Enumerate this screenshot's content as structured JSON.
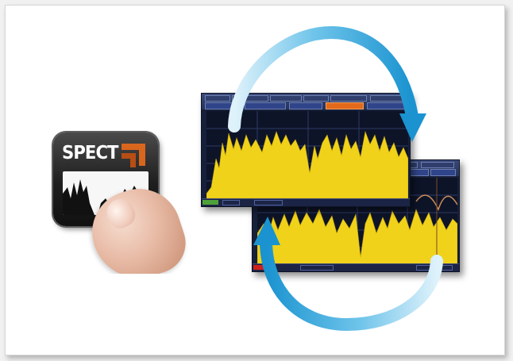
{
  "spect_key": {
    "label": "SPECT",
    "icon": "spectrum-waveform-icon",
    "arrow_icon": "orange-corner-arrow-icon"
  },
  "screens": [
    {
      "id": "spectrum-view-1",
      "trace_color": "#f0d21a",
      "status_indicator_color": "#4fa13a"
    },
    {
      "id": "spectrum-view-2",
      "trace_color": "#f0d21a",
      "status_indicator_color": "#d0201c"
    }
  ],
  "swap_arrows": {
    "color": "#3aa9df",
    "icons": [
      "cycle-arrow-top-icon",
      "cycle-arrow-bottom-icon"
    ]
  },
  "colors": {
    "accent_orange": "#e36a1b",
    "screen_bg": "#17203a",
    "trace_yellow": "#f0d21a",
    "arrow_blue": "#3aa9df"
  }
}
